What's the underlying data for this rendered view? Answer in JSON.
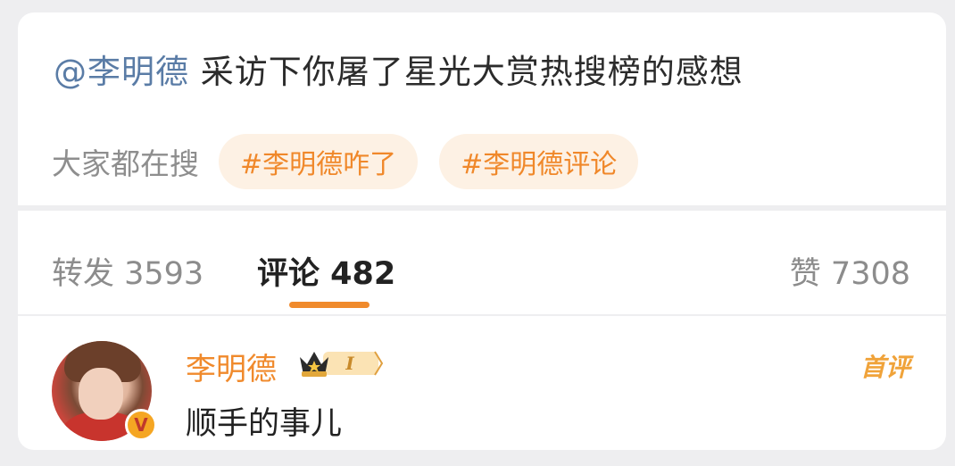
{
  "post": {
    "mention": "@李明德",
    "text": " 采访下你屠了星光大赏热搜榜的感想"
  },
  "search": {
    "label": "大家都在搜",
    "tags": [
      "#李明德咋了",
      "#李明德评论"
    ]
  },
  "tabs": {
    "repost": "转发 3593",
    "comment": "评论 482",
    "like": "赞 7308"
  },
  "comment": {
    "author": "李明德",
    "vip_level": "I",
    "text": "顺手的事儿",
    "first_label": "首评",
    "verified_mark": "V"
  },
  "colors": {
    "accent": "#f08a2c",
    "mention": "#5a7ca6",
    "tag_bg": "#fdf1e4"
  }
}
